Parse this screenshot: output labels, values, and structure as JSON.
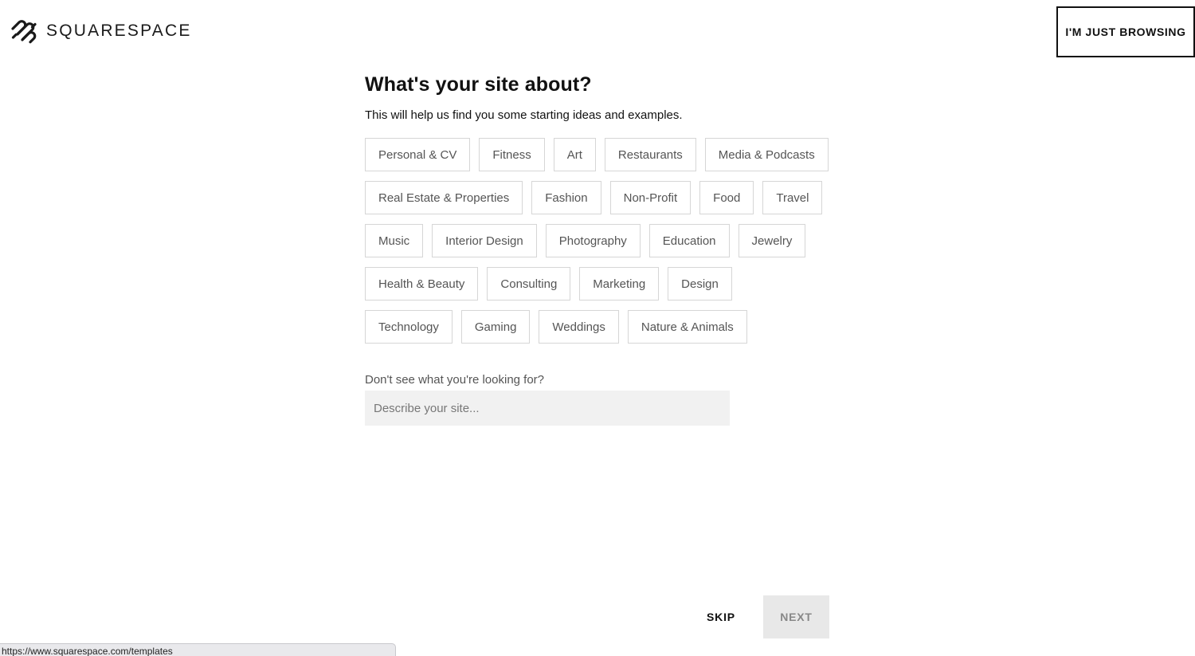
{
  "header": {
    "brand": "SQUARESPACE",
    "brand_icon": "squarespace-logo-icon",
    "browse_label": "I'M JUST BROWSING"
  },
  "main": {
    "title": "What's your site about?",
    "subtitle": "This will help us find you some starting ideas and examples.",
    "categories": [
      [
        "Personal & CV",
        "Fitness",
        "Art",
        "Restaurants",
        "Media & Podcasts"
      ],
      [
        "Real Estate & Properties",
        "Fashion",
        "Non-Profit",
        "Food",
        "Travel"
      ],
      [
        "Music",
        "Interior Design",
        "Photography",
        "Education",
        "Jewelry"
      ],
      [
        "Health & Beauty",
        "Consulting",
        "Marketing",
        "Design"
      ],
      [
        "Technology",
        "Gaming",
        "Weddings",
        "Nature & Animals"
      ]
    ],
    "describe_label": "Don't see what you're looking for?",
    "describe_placeholder": "Describe your site..."
  },
  "footer": {
    "skip_label": "SKIP",
    "next_label": "NEXT"
  },
  "status_bar": {
    "url": "https://www.squarespace.com/templates"
  },
  "colors": {
    "text": "#111111",
    "chip_border": "#d6d6d6",
    "input_bg": "#f1f1f1",
    "next_bg": "#e8e8e8"
  }
}
